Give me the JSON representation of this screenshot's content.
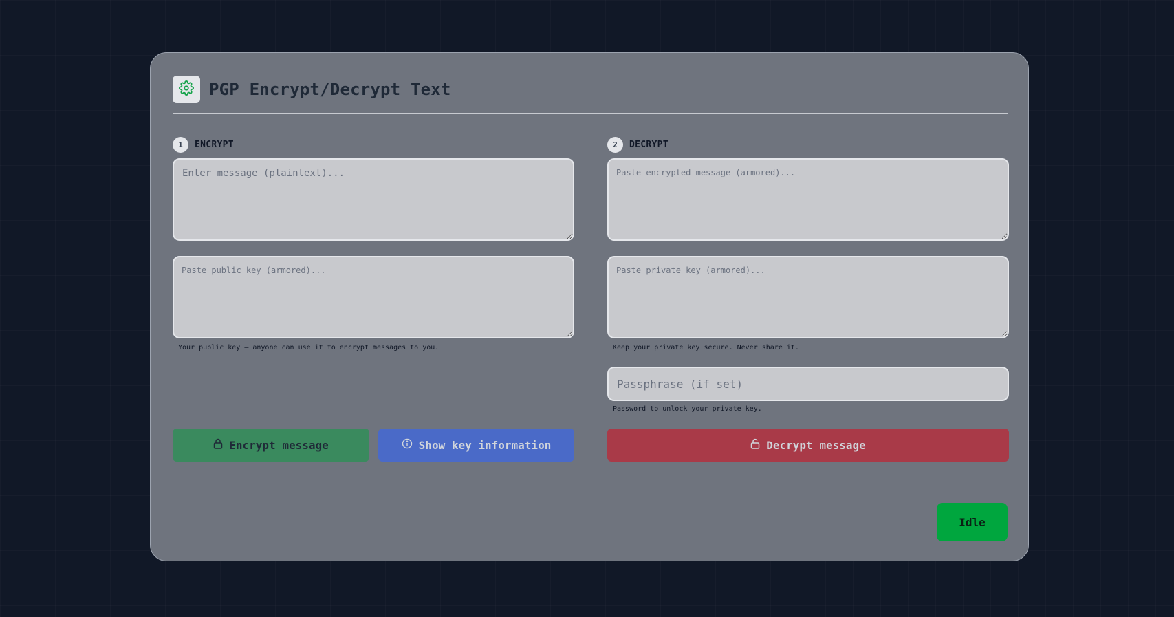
{
  "app": {
    "title": "PGP Encrypt/Decrypt Text",
    "logo_icon": "gear-icon",
    "accent_color": "#16a34a"
  },
  "encrypt": {
    "step": "1",
    "heading": "ENCRYPT",
    "message_placeholder": "Enter message (plaintext)...",
    "public_key_placeholder": "Paste public key (armored)...",
    "public_key_hint": "Your public key – anyone can use it to encrypt messages to you.",
    "encrypt_button": "Encrypt message",
    "encrypt_button_icon": "lock-icon",
    "encrypt_button_color": "#3a8a5e",
    "info_button": "Show key information",
    "info_button_icon": "info-icon",
    "info_button_color": "#4a6ac8"
  },
  "decrypt": {
    "step": "2",
    "heading": "DECRYPT",
    "message_placeholder": "Paste encrypted message (armored)...",
    "private_key_placeholder": "Paste private key (armored)...",
    "private_key_hint": "Keep your private key secure. Never share it.",
    "passphrase_placeholder": "Passphrase (if set)",
    "passphrase_hint": "Password to unlock your private key.",
    "decrypt_button": "Decrypt message",
    "decrypt_button_icon": "unlock-icon",
    "decrypt_button_color": "#a93a48"
  },
  "status": {
    "label": "Idle",
    "color": "#00a63e"
  }
}
